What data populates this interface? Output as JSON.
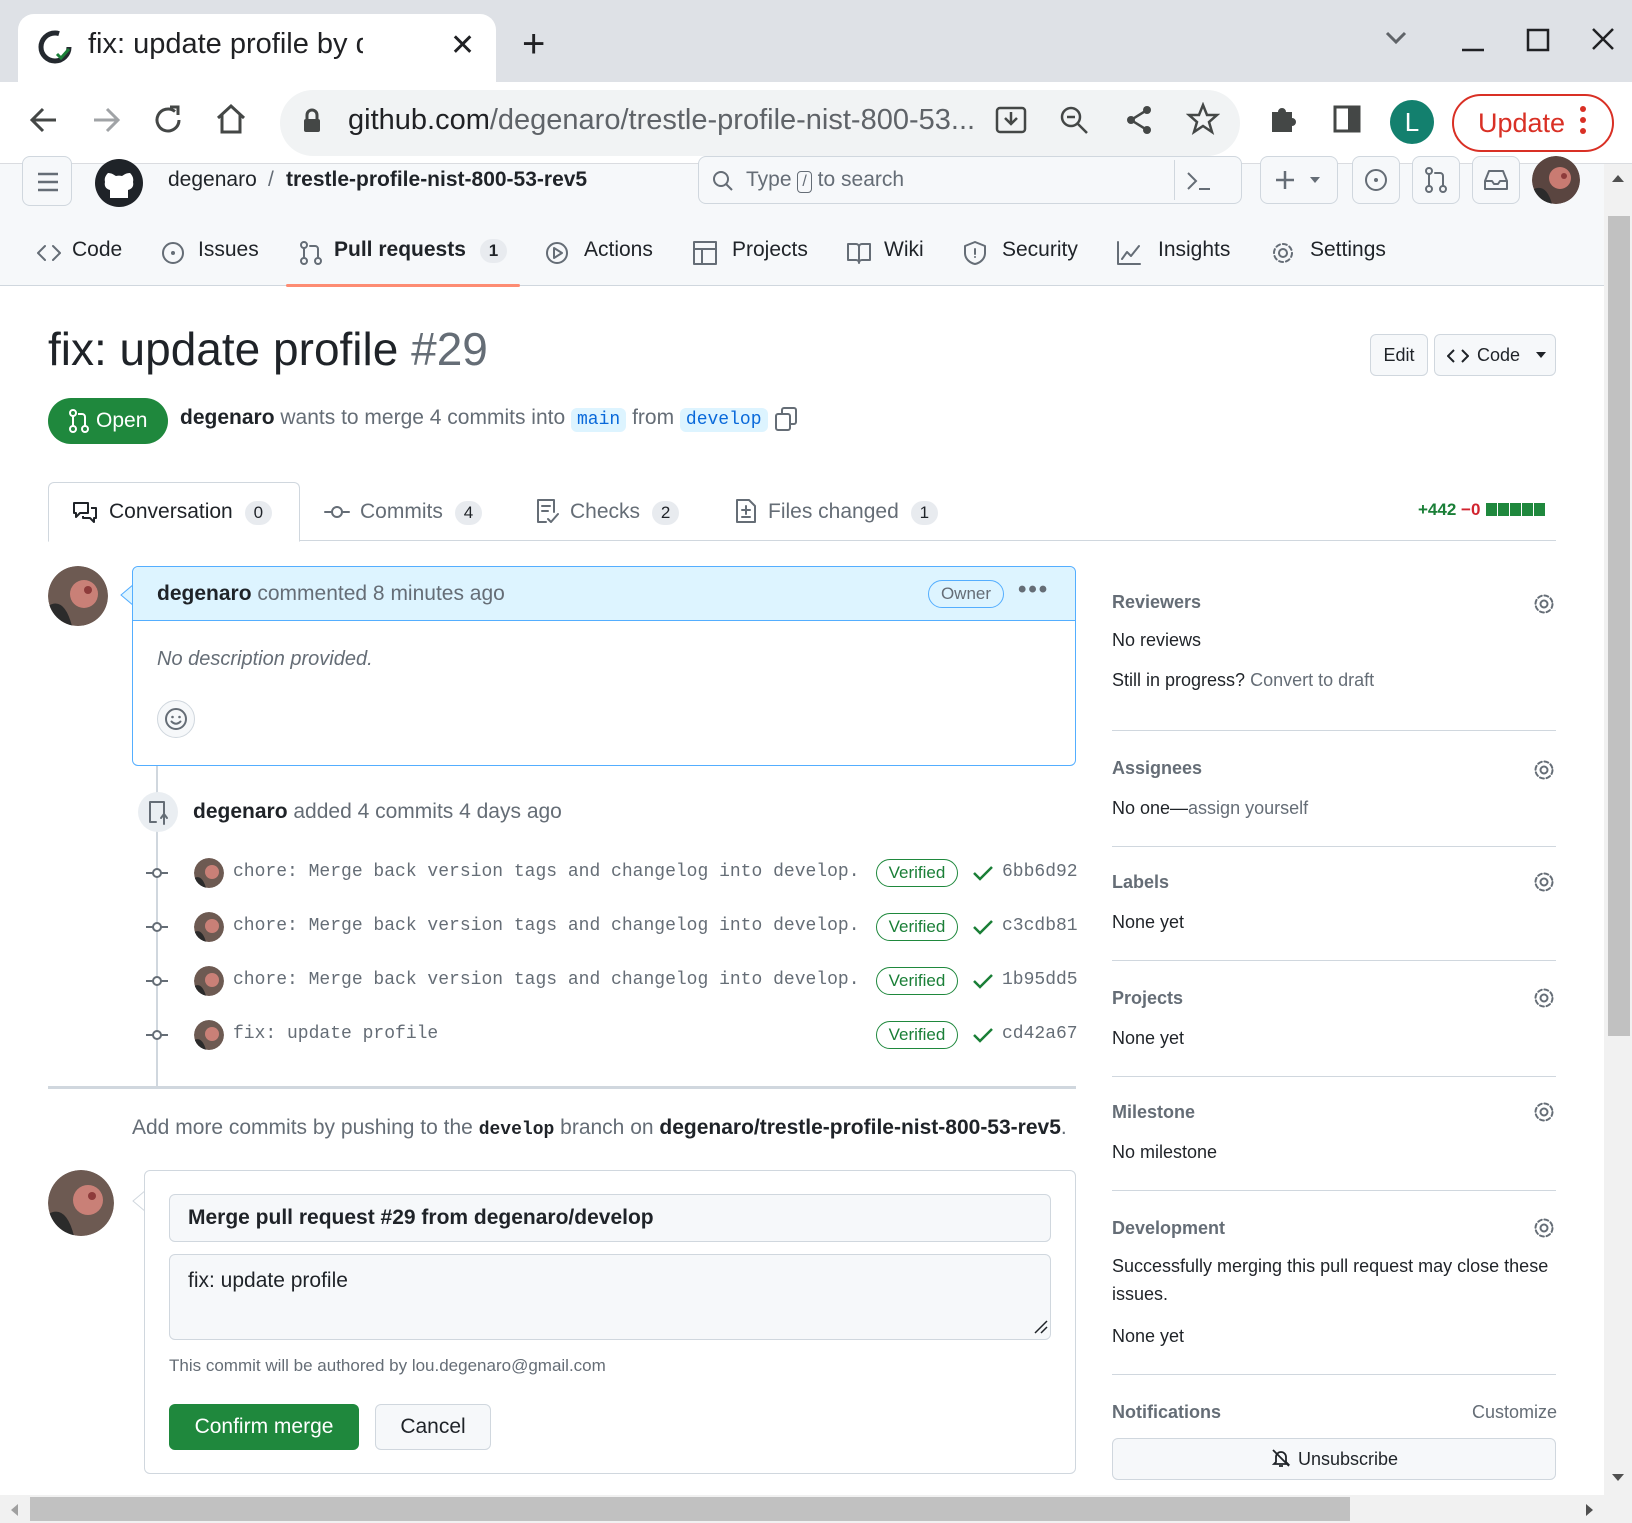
{
  "browser": {
    "tab_title": "fix: update profile by degenaro",
    "url_host": "github.com",
    "url_path": "/degenaro/trestle-profile-nist-800-53...",
    "profile_initial": "L",
    "update_label": "Update"
  },
  "header": {
    "owner": "degenaro",
    "separator": "/",
    "repo": "trestle-profile-nist-800-53-rev5",
    "search_prefix": "Type",
    "search_key": "/",
    "search_suffix": "to search"
  },
  "repo_nav": [
    {
      "label": "Code",
      "icon": "code-icon"
    },
    {
      "label": "Issues",
      "icon": "issue-icon"
    },
    {
      "label": "Pull requests",
      "icon": "pull-request-icon",
      "count": "1"
    },
    {
      "label": "Actions",
      "icon": "play-icon"
    },
    {
      "label": "Projects",
      "icon": "table-icon"
    },
    {
      "label": "Wiki",
      "icon": "book-icon"
    },
    {
      "label": "Security",
      "icon": "shield-icon"
    },
    {
      "label": "Insights",
      "icon": "graph-icon"
    },
    {
      "label": "Settings",
      "icon": "gear-icon"
    }
  ],
  "pr": {
    "title": "fix: update profile",
    "number": "#29",
    "edit_label": "Edit",
    "code_label": "Code",
    "state": "Open",
    "author": "degenaro",
    "merge_text_1": "wants to merge 4 commits into",
    "base_branch": "main",
    "merge_text_2": "from",
    "head_branch": "develop"
  },
  "pr_tabs": [
    {
      "label": "Conversation",
      "count": "0"
    },
    {
      "label": "Commits",
      "count": "4"
    },
    {
      "label": "Checks",
      "count": "2"
    },
    {
      "label": "Files changed",
      "count": "1"
    }
  ],
  "diffstat": {
    "added": "+442",
    "removed": "−0"
  },
  "comment": {
    "author": "degenaro",
    "action": "commented 8 minutes ago",
    "badge": "Owner",
    "body": "No description provided."
  },
  "push_event": {
    "author": "degenaro",
    "text": "added 4 commits 4 days ago"
  },
  "commits": [
    {
      "message": "chore: Merge back version tags and changelog into develop.",
      "verified": "Verified",
      "sha": "6bb6d92"
    },
    {
      "message": "chore: Merge back version tags and changelog into develop.",
      "verified": "Verified",
      "sha": "c3cdb81"
    },
    {
      "message": "chore: Merge back version tags and changelog into develop.",
      "verified": "Verified",
      "sha": "1b95dd5"
    },
    {
      "message": "fix: update profile",
      "verified": "Verified",
      "sha": "cd42a67"
    }
  ],
  "add_more": {
    "prefix": "Add more commits by pushing to the",
    "branch": "develop",
    "middle": "branch on",
    "repo": "degenaro/trestle-profile-nist-800-53-rev5",
    "suffix": "."
  },
  "merge": {
    "title_value": "Merge pull request #29 from degenaro/develop",
    "body_value": "fix: update profile",
    "author_note": "This commit will be authored by lou.degenaro@gmail.com",
    "confirm_label": "Confirm merge",
    "cancel_label": "Cancel"
  },
  "sidebar": {
    "reviewers": {
      "heading": "Reviewers",
      "value": "No reviews",
      "progress": "Still in progress?",
      "draft_link": "Convert to draft"
    },
    "assignees": {
      "heading": "Assignees",
      "value": "No one—",
      "link": "assign yourself"
    },
    "labels": {
      "heading": "Labels",
      "value": "None yet"
    },
    "projects": {
      "heading": "Projects",
      "value": "None yet"
    },
    "milestone": {
      "heading": "Milestone",
      "value": "No milestone"
    },
    "development": {
      "heading": "Development",
      "line1": "Successfully merging this pull request may close these",
      "line2": "issues.",
      "value": "None yet"
    },
    "notifications": {
      "heading": "Notifications",
      "customize": "Customize",
      "unsubscribe": "Unsubscribe"
    }
  },
  "colors": {
    "open_green": "#1f883d",
    "accent_blue": "#0969da",
    "nav_underline": "#fd8c73",
    "update_red": "#d93025"
  }
}
